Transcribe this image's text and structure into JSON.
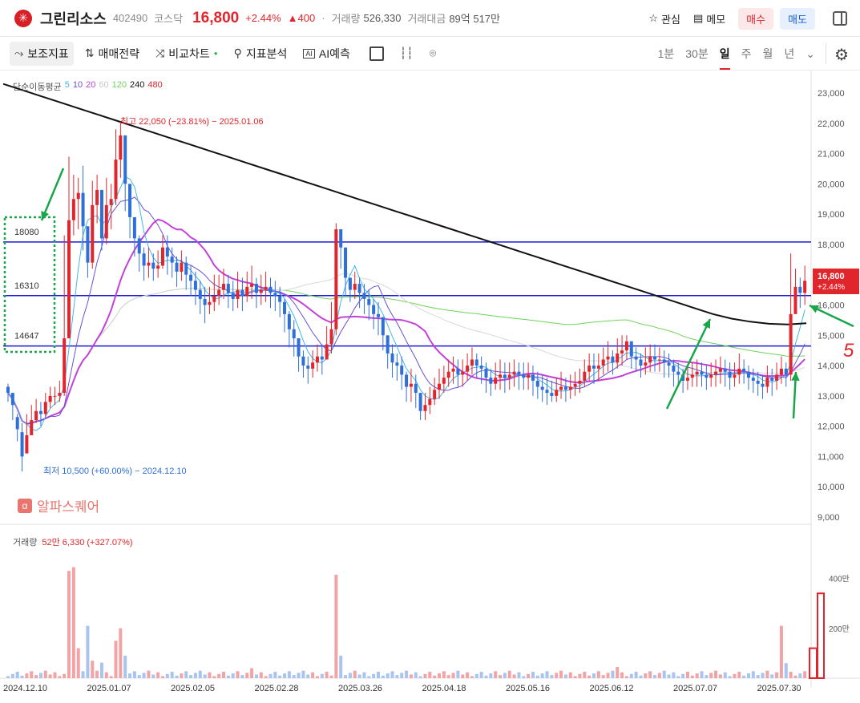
{
  "header": {
    "name": "그린리소스",
    "code": "402490",
    "market": "코스닥",
    "price": "16,800",
    "change_pct": "+2.44%",
    "change_abs": "▲400",
    "dot": "·",
    "volume_label": "거래량",
    "volume": "526,330",
    "amount_label": "거래대금",
    "amount": "89억 517만",
    "watch": "관심",
    "memo": "메모",
    "buy": "매수",
    "sell": "매도"
  },
  "toolbar": {
    "indicators": "보조지표",
    "strategy": "매매전략",
    "compare": "비교차트",
    "analysis": "지표분석",
    "ai": "AI예측",
    "periods": [
      "1분",
      "30분",
      "일",
      "주",
      "월",
      "년"
    ],
    "selected_period": "일"
  },
  "ma_legend": {
    "label": "단순이동평균",
    "items": [
      {
        "text": "5",
        "color": "#40b8e8"
      },
      {
        "text": "10",
        "color": "#6a4fd6"
      },
      {
        "text": "20",
        "color": "#c242d8"
      },
      {
        "text": "60",
        "color": "#c8c8c8"
      },
      {
        "text": "120",
        "color": "#6fd35a"
      },
      {
        "text": "240",
        "color": "#111111"
      },
      {
        "text": "480",
        "color": "#e0262c"
      }
    ]
  },
  "annotations": {
    "high": "최고 22,050 (−23.81%) − 2025.01.06",
    "low": "최저 10,500 (+60.00%) − 2024.12.10",
    "current_price": "16,800",
    "current_pct": "+2.44%",
    "watermark": "알파스퀘어",
    "handwritten": "5"
  },
  "volume_legend": {
    "label": "거래량",
    "value": "52만 6,330 (+327.07%)"
  },
  "chart_data": {
    "type": "candlestick",
    "price_axis": {
      "ylim": [
        9000,
        23500
      ],
      "ticks": [
        "23,000",
        "22,000",
        "21,000",
        "20,000",
        "19,000",
        "18,000",
        "17,000",
        "16,000",
        "15,000",
        "14,000",
        "13,000",
        "12,000",
        "11,000",
        "10,000",
        "9,000"
      ]
    },
    "volume_axis": {
      "ylim": [
        0,
        4500000
      ],
      "ticks": [
        "400만",
        "200만"
      ]
    },
    "x_labels": [
      "2024.12.10",
      "2025.01.07",
      "2025.02.05",
      "2025.02.28",
      "2025.03.26",
      "2025.04.18",
      "2025.05.16",
      "2025.06.12",
      "2025.07.07",
      "2025.07.30"
    ],
    "horizontal_levels": [
      {
        "label": "18080",
        "value": 18080
      },
      {
        "label": "16310",
        "value": 16310
      },
      {
        "label": "14647",
        "value": 14647
      }
    ],
    "closes": [
      13100,
      12700,
      11900,
      11000,
      11700,
      12200,
      12500,
      12400,
      12800,
      13000,
      13000,
      13100,
      14900,
      18800,
      19500,
      19700,
      18600,
      17400,
      19300,
      19800,
      18200,
      19300,
      19500,
      20800,
      21600,
      20000,
      18900,
      18200,
      17700,
      17300,
      17400,
      17200,
      17300,
      17900,
      17600,
      17400,
      17100,
      17400,
      17000,
      16800,
      16500,
      16200,
      16000,
      16100,
      16300,
      16500,
      16700,
      16400,
      16200,
      16500,
      16300,
      16600,
      16700,
      16400,
      16500,
      16600,
      16400,
      16300,
      16100,
      15700,
      15200,
      14900,
      14300,
      14000,
      13900,
      14100,
      14300,
      14200,
      14700,
      15200,
      18500,
      17900,
      16900,
      16500,
      16700,
      16400,
      16200,
      16000,
      15700,
      15600,
      15000,
      14400,
      14100,
      14000,
      13700,
      13300,
      13400,
      13100,
      12500,
      12700,
      12900,
      13200,
      13400,
      13600,
      13800,
      13900,
      13700,
      13800,
      14000,
      14200,
      14000,
      13900,
      13600,
      13400,
      13600,
      13700,
      13600,
      13700,
      13800,
      13700,
      13600,
      13700,
      13500,
      13300,
      13200,
      13100,
      13000,
      13200,
      13300,
      13200,
      13300,
      13400,
      13500,
      13800,
      14000,
      13900,
      14000,
      14200,
      14300,
      14100,
      14400,
      14500,
      14800,
      14300,
      14200,
      14000,
      14100,
      14300,
      14200,
      14200,
      14100,
      14000,
      13800,
      13700,
      13500,
      13600,
      13700,
      13800,
      13700,
      13600,
      13700,
      13800,
      13900,
      13800,
      13600,
      13700,
      13900,
      13800,
      13600,
      13500,
      13400,
      13300,
      13600,
      13500,
      13700,
      13900,
      13700,
      15700,
      16600,
      16400,
      16800
    ],
    "highs": [
      13400,
      13000,
      12400,
      12100,
      12400,
      12700,
      12900,
      12800,
      13100,
      13300,
      13300,
      13500,
      18300,
      20900,
      20300,
      20200,
      20600,
      18600,
      20100,
      20300,
      19800,
      20200,
      20000,
      21800,
      22050,
      20900,
      19700,
      18900,
      18300,
      17900,
      17900,
      17700,
      17800,
      18300,
      18300,
      17900,
      17600,
      17800,
      17600,
      17300,
      17100,
      16800,
      16600,
      16600,
      17000,
      17000,
      17200,
      17000,
      16800,
      17100,
      16900,
      17100,
      17300,
      16900,
      17000,
      17100,
      16900,
      16800,
      16600,
      16200,
      15800,
      15500,
      14900,
      14500,
      14300,
      14500,
      14700,
      14700,
      15300,
      16100,
      18700,
      18400,
      17500,
      16900,
      17100,
      16900,
      16700,
      16500,
      16200,
      16100,
      15600,
      14900,
      14700,
      14400,
      14300,
      13800,
      13900,
      13700,
      13000,
      13100,
      13300,
      13600,
      13900,
      14000,
      14200,
      14300,
      14200,
      14200,
      14400,
      14600,
      14400,
      14300,
      14100,
      13900,
      14100,
      14200,
      14100,
      14100,
      14200,
      14100,
      14100,
      14100,
      14000,
      13800,
      13700,
      13600,
      13500,
      13600,
      13800,
      13600,
      13700,
      13800,
      13900,
      14200,
      14400,
      14400,
      14400,
      14600,
      14800,
      14500,
      14900,
      15000,
      15000,
      14800,
      14600,
      14400,
      14600,
      14700,
      14700,
      14600,
      14500,
      14400,
      14200,
      14100,
      13900,
      14000,
      14100,
      14200,
      14100,
      14000,
      14100,
      14200,
      14300,
      14200,
      14100,
      14100,
      14400,
      14200,
      14000,
      13900,
      13800,
      13700,
      14000,
      13900,
      14100,
      14300,
      14100,
      17700,
      17200,
      16900,
      17300
    ],
    "lows": [
      12800,
      12200,
      11500,
      10500,
      11200,
      11800,
      12100,
      12000,
      12300,
      12600,
      12700,
      12800,
      13000,
      14900,
      18300,
      18500,
      17800,
      16900,
      17200,
      18700,
      17800,
      18000,
      18500,
      19300,
      20200,
      19100,
      18200,
      17600,
      17100,
      16800,
      16900,
      16800,
      16900,
      17200,
      17000,
      16900,
      16600,
      16800,
      16500,
      16300,
      16000,
      15700,
      15400,
      15700,
      15800,
      16000,
      16200,
      15900,
      15800,
      15900,
      15800,
      16100,
      16200,
      15900,
      16000,
      16100,
      15900,
      15800,
      15600,
      15100,
      14600,
      14300,
      13800,
      13600,
      13400,
      13600,
      13800,
      13700,
      14200,
      14400,
      15000,
      17200,
      16300,
      16100,
      16200,
      15900,
      15700,
      15500,
      15200,
      15000,
      14500,
      13900,
      13600,
      13500,
      13200,
      12800,
      12800,
      12600,
      12200,
      12200,
      12400,
      12700,
      12900,
      13100,
      13300,
      13400,
      13300,
      13300,
      13500,
      13700,
      13600,
      13400,
      13100,
      13000,
      13200,
      13200,
      13100,
      13200,
      13300,
      13200,
      13200,
      13200,
      13000,
      12900,
      12800,
      12700,
      12800,
      12800,
      12900,
      12800,
      12900,
      13000,
      13100,
      13300,
      13500,
      13400,
      13500,
      13700,
      13800,
      13700,
      13900,
      14000,
      14200,
      13900,
      13800,
      13600,
      13700,
      13800,
      13800,
      13800,
      13600,
      13600,
      13300,
      13300,
      13100,
      13200,
      13300,
      13300,
      13300,
      13200,
      13300,
      13300,
      13400,
      13300,
      13200,
      13300,
      13400,
      13400,
      13200,
      13100,
      13000,
      12900,
      13100,
      13000,
      13200,
      13400,
      13300,
      13500,
      15800,
      15900,
      16000
    ],
    "opens": [
      13300,
      13100,
      12300,
      11800,
      11100,
      11700,
      12200,
      12500,
      12400,
      12800,
      13000,
      13000,
      13100,
      14900,
      18800,
      19500,
      19700,
      18600,
      17400,
      19300,
      19800,
      18200,
      19300,
      19500,
      20800,
      21600,
      20000,
      18900,
      18200,
      17700,
      17300,
      17400,
      17200,
      17300,
      17900,
      17600,
      17400,
      17100,
      17400,
      17000,
      16800,
      16500,
      16200,
      16000,
      16100,
      16300,
      16500,
      16700,
      16400,
      16200,
      16500,
      16300,
      16600,
      16700,
      16400,
      16500,
      16600,
      16400,
      16300,
      16100,
      15700,
      15200,
      14900,
      14300,
      14000,
      13900,
      14100,
      14300,
      14200,
      14700,
      15200,
      18500,
      17900,
      16900,
      16500,
      16700,
      16400,
      16200,
      16000,
      15700,
      15600,
      15000,
      14400,
      14100,
      14000,
      13700,
      13300,
      13400,
      13100,
      12500,
      12700,
      12900,
      13200,
      13400,
      13600,
      13800,
      13900,
      13700,
      13800,
      14000,
      14200,
      14000,
      13900,
      13600,
      13400,
      13600,
      13700,
      13600,
      13700,
      13800,
      13700,
      13600,
      13700,
      13500,
      13300,
      13200,
      13100,
      13000,
      13200,
      13300,
      13200,
      13300,
      13400,
      13500,
      13800,
      14000,
      13900,
      14000,
      14200,
      14300,
      14100,
      14400,
      14500,
      14800,
      14300,
      14200,
      14000,
      14100,
      14300,
      14200,
      14200,
      14100,
      14000,
      13800,
      13700,
      13500,
      13600,
      13700,
      13800,
      13700,
      13600,
      13700,
      13800,
      13900,
      13800,
      13600,
      13700,
      13900,
      13800,
      13600,
      13500,
      13400,
      13300,
      13600,
      13500,
      13700,
      13900,
      13700,
      15700,
      16600,
      16400
    ],
    "ma240": [
      23300,
      23100,
      22900,
      22700,
      22500,
      22300,
      22100,
      21900,
      21700,
      21500,
      21300,
      21100,
      20900,
      20700,
      20500,
      20300,
      20100,
      19900,
      19700,
      19500,
      19300,
      19100,
      18900,
      18700,
      18500,
      18300,
      18100,
      17900,
      17700,
      17500,
      17300,
      17100,
      16900,
      16700,
      16500,
      16300,
      16100,
      15900,
      15700,
      15550,
      15450,
      15380,
      15360,
      15400
    ]
  }
}
